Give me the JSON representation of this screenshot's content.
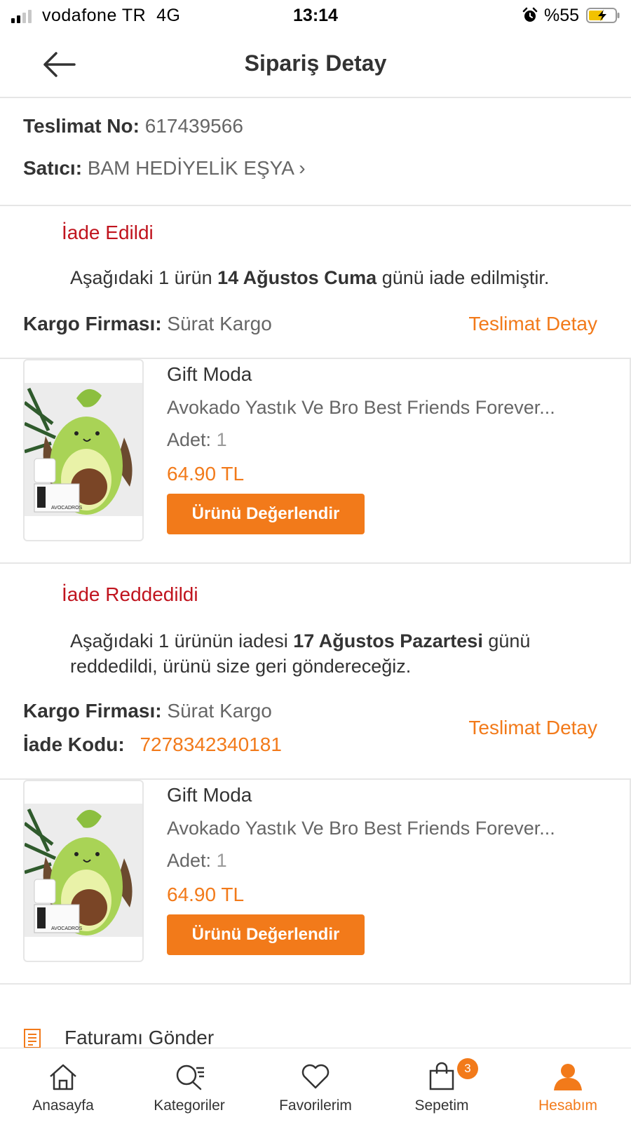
{
  "status_bar": {
    "carrier": "vodafone TR",
    "network": "4G",
    "time": "13:14",
    "battery": "%55"
  },
  "nav": {
    "title": "Sipariş Detay"
  },
  "delivery": {
    "number_label": "Teslimat No:",
    "number": "617439566",
    "seller_label": "Satıcı:",
    "seller": "BAM HEDİYELİK EŞYA",
    "seller_chevron": "›"
  },
  "packages": [
    {
      "status": "İade Edildi",
      "desc_pre": "Aşağıdaki 1 ürün ",
      "desc_date": "14 Ağustos Cuma",
      "desc_post": " günü iade edilmiştir.",
      "cargo_label": "Kargo Firması:",
      "cargo": "Sürat Kargo",
      "detail_link": "Teslimat Detay",
      "product": {
        "brand": "Gift Moda",
        "name": "Avokado Yastık Ve Bro Best Friends Forever...",
        "qty_label": "Adet:",
        "qty": "1",
        "price": "64.90 TL",
        "button": "Ürünü Değerlendir",
        "image_text": "AVOCADROS"
      }
    },
    {
      "status": "İade Reddedildi",
      "desc_pre": "Aşağıdaki 1 ürünün iadesi ",
      "desc_date": "17 Ağustos Pazartesi",
      "desc_post": " günü reddedildi, ürünü size geri göndereceğiz.",
      "cargo_label": "Kargo Firması:",
      "cargo": "Sürat Kargo",
      "refund_label": "İade Kodu:",
      "refund_code": "7278342340181",
      "detail_link": "Teslimat Detay",
      "product": {
        "brand": "Gift Moda",
        "name": "Avokado Yastık Ve Bro Best Friends Forever...",
        "qty_label": "Adet:",
        "qty": "1",
        "price": "64.90 TL",
        "button": "Ürünü Değerlendir",
        "image_text": "AVOCADROS"
      }
    }
  ],
  "invoice": {
    "label": "Faturamı Gönder",
    "icon": "document-icon"
  },
  "tabs": [
    {
      "label": "Anasayfa",
      "icon": "home-icon"
    },
    {
      "label": "Kategoriler",
      "icon": "search-filter-icon"
    },
    {
      "label": "Favorilerim",
      "icon": "heart-icon"
    },
    {
      "label": "Sepetim",
      "icon": "shopping-bag-icon",
      "badge": "3"
    },
    {
      "label": "Hesabım",
      "icon": "user-icon",
      "active": true
    }
  ],
  "colors": {
    "accent": "#f27a1a",
    "status_red": "#c0141e",
    "text": "#333333",
    "muted": "#666666"
  }
}
